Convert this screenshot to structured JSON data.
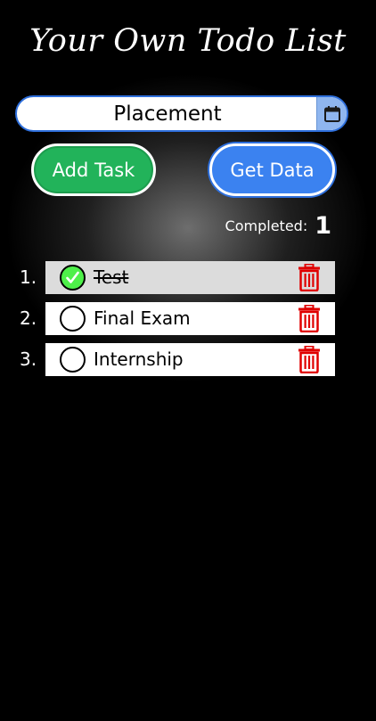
{
  "app": {
    "title": "Your Own Todo List"
  },
  "task_input": {
    "value": "Placement",
    "calendar_icon": "calendar-icon"
  },
  "buttons": {
    "add_label": "Add Task",
    "get_label": "Get Data"
  },
  "completed": {
    "label": "Completed:",
    "count": "1"
  },
  "tasks": [
    {
      "number": "1.",
      "text": "Test",
      "done": true
    },
    {
      "number": "2.",
      "text": "Final Exam",
      "done": false
    },
    {
      "number": "3.",
      "text": "Internship",
      "done": false
    }
  ],
  "colors": {
    "background": "#000000",
    "add_button": "#22b35a",
    "get_button": "#3b82f0",
    "input_border": "#2e6fdc",
    "check_done": "#4ef04a",
    "trash": "#e00000",
    "done_row": "#dcdcdc"
  }
}
